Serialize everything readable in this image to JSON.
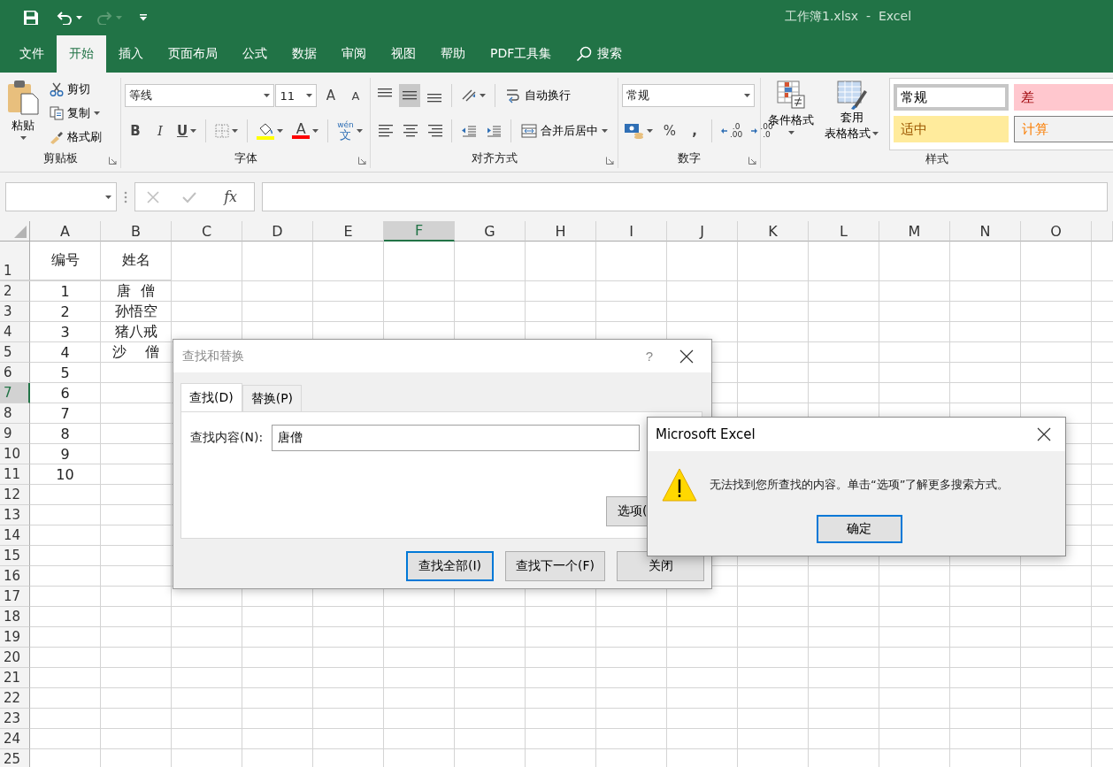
{
  "title_bar": {
    "title": "工作簿1.xlsx  -  Excel"
  },
  "ribbon_tabs": [
    {
      "label": "文件",
      "selected": false
    },
    {
      "label": "开始",
      "selected": true
    },
    {
      "label": "插入",
      "selected": false
    },
    {
      "label": "页面布局",
      "selected": false
    },
    {
      "label": "公式",
      "selected": false
    },
    {
      "label": "数据",
      "selected": false
    },
    {
      "label": "审阅",
      "selected": false
    },
    {
      "label": "视图",
      "selected": false
    },
    {
      "label": "帮助",
      "selected": false
    },
    {
      "label": "PDF工具集",
      "selected": false
    }
  ],
  "search": {
    "label": "搜索"
  },
  "clipboard": {
    "paste": "粘贴",
    "cut": "剪切",
    "copy": "复制",
    "format_painter": "格式刷",
    "label": "剪贴板"
  },
  "font": {
    "name": "等线",
    "size": "11",
    "grow": "A",
    "shrink": "A",
    "bold": "B",
    "italic": "I",
    "underline": "U",
    "font_color": "A",
    "phonetic": "wén",
    "phonetic_char": "文",
    "label": "字体"
  },
  "alignment": {
    "vertical_align": [
      {
        "selected": false
      },
      {
        "selected": true
      },
      {
        "selected": false
      }
    ],
    "wrap_text": "自动换行",
    "merge": "合并后居中",
    "label": "对齐方式"
  },
  "number": {
    "format": "常规",
    "percent": "%",
    "comma": ",",
    "increase_decimal": [
      ".0",
      ".00"
    ],
    "decrease_decimal": [
      ".00",
      ".0"
    ],
    "label": "数字"
  },
  "styles": {
    "conditional_format": "条件格式",
    "table_format": [
      "套用",
      "表格格式"
    ],
    "gallery": [
      {
        "label": "常规",
        "kind": "normal",
        "selected": true
      },
      {
        "label": "差",
        "kind": "bad",
        "selected": false
      },
      {
        "label": "适中",
        "kind": "neutral",
        "selected": false
      },
      {
        "label": "计算",
        "kind": "calculation",
        "selected": false
      }
    ],
    "label": "样式"
  },
  "formula_bar": {
    "function_label": "fx"
  },
  "sheet": {
    "columns": [
      {
        "label": "A",
        "selected": false
      },
      {
        "label": "B",
        "selected": false
      },
      {
        "label": "C",
        "selected": false
      },
      {
        "label": "D",
        "selected": false
      },
      {
        "label": "E",
        "selected": false
      },
      {
        "label": "F",
        "selected": true
      },
      {
        "label": "G",
        "selected": false
      },
      {
        "label": "H",
        "selected": false
      },
      {
        "label": "I",
        "selected": false
      },
      {
        "label": "J",
        "selected": false
      },
      {
        "label": "K",
        "selected": false
      },
      {
        "label": "L",
        "selected": false
      },
      {
        "label": "M",
        "selected": false
      },
      {
        "label": "N",
        "selected": false
      },
      {
        "label": "O",
        "selected": false
      }
    ],
    "rows": [
      {
        "header": "1",
        "selected": false,
        "cells": [
          "编号",
          "姓名"
        ]
      },
      {
        "header": "2",
        "selected": false,
        "cells": [
          "1",
          "唐  僧"
        ]
      },
      {
        "header": "3",
        "selected": false,
        "cells": [
          "2",
          "孙悟空"
        ]
      },
      {
        "header": "4",
        "selected": false,
        "cells": [
          "3",
          "猪八戒"
        ]
      },
      {
        "header": "5",
        "selected": false,
        "cells": [
          "4",
          "沙    僧"
        ]
      },
      {
        "header": "6",
        "selected": false,
        "cells": [
          "5"
        ]
      },
      {
        "header": "7",
        "selected": true,
        "cells": [
          "6"
        ]
      },
      {
        "header": "8",
        "selected": false,
        "cells": [
          "7"
        ]
      },
      {
        "header": "9",
        "selected": false,
        "cells": [
          "8"
        ]
      },
      {
        "header": "10",
        "selected": false,
        "cells": [
          "9"
        ]
      },
      {
        "header": "11",
        "selected": false,
        "cells": [
          "10"
        ]
      },
      {
        "header": "12",
        "selected": false,
        "cells": []
      },
      {
        "header": "13",
        "selected": false,
        "cells": []
      },
      {
        "header": "14",
        "selected": false,
        "cells": []
      },
      {
        "header": "15",
        "selected": false,
        "cells": []
      },
      {
        "header": "16",
        "selected": false,
        "cells": []
      },
      {
        "header": "17",
        "selected": false,
        "cells": []
      },
      {
        "header": "18",
        "selected": false,
        "cells": []
      },
      {
        "header": "19",
        "selected": false,
        "cells": []
      },
      {
        "header": "20",
        "selected": false,
        "cells": []
      },
      {
        "header": "21",
        "selected": false,
        "cells": []
      },
      {
        "header": "22",
        "selected": false,
        "cells": []
      },
      {
        "header": "23",
        "selected": false,
        "cells": []
      },
      {
        "header": "24",
        "selected": false,
        "cells": []
      },
      {
        "header": "25",
        "selected": false,
        "cells": []
      }
    ]
  },
  "find_dialog": {
    "title": "查找和替换",
    "help": "?",
    "tabs": [
      {
        "label": "查找(D)",
        "selected": true
      },
      {
        "label": "替换(P)",
        "selected": false
      }
    ],
    "field_label": "查找内容(N):",
    "value": "唐僧",
    "options_button": "选项(",
    "buttons": [
      {
        "label": "查找全部(I)",
        "default": true
      },
      {
        "label": "查找下一个(F)",
        "default": false
      },
      {
        "label": "关闭",
        "default": false
      }
    ]
  },
  "message_box": {
    "title": "Microsoft Excel",
    "message": "无法找到您所查找的内容。单击“选项”了解更多搜索方式。",
    "ok": "确定"
  }
}
